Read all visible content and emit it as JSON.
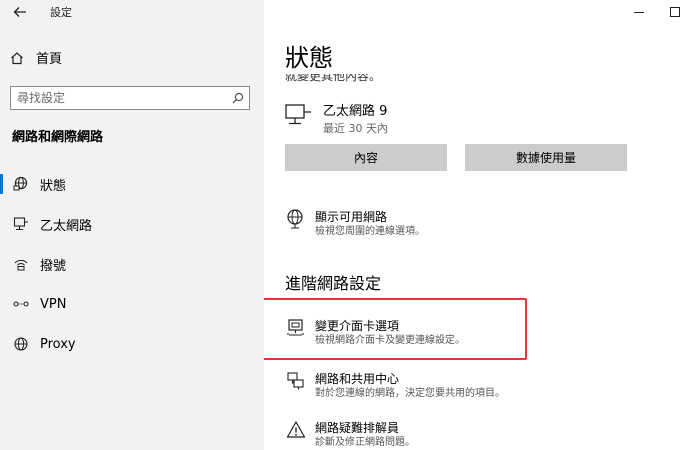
{
  "window": {
    "title": "設定",
    "minimize_icon": "minimize-icon",
    "maximize_icon": "maximize-icon"
  },
  "sidebar": {
    "home_label": "首頁",
    "search_placeholder": "尋找設定",
    "section_title": "網路和網際網路",
    "items": [
      {
        "label": "狀態",
        "icon": "globe-status-icon",
        "active": true
      },
      {
        "label": "乙太網路",
        "icon": "ethernet-icon",
        "active": false
      },
      {
        "label": "撥號",
        "icon": "dialup-icon",
        "active": false
      },
      {
        "label": "VPN",
        "icon": "vpn-icon",
        "active": false
      },
      {
        "label": "Proxy",
        "icon": "globe-icon",
        "active": false
      }
    ]
  },
  "main": {
    "title": "狀態",
    "cutoff_text": "就變更其他內容。",
    "connection": {
      "name": "乙太網路 9",
      "subtitle": "最近 30 天內"
    },
    "buttons": {
      "properties": "內容",
      "data_usage": "數據使用量"
    },
    "show_networks": {
      "title": "顯示可用網路",
      "desc": "檢視您周圍的連線選項。"
    },
    "advanced_heading": "進階網路設定",
    "advanced_items": [
      {
        "title": "變更介面卡選項",
        "desc": "檢視網路介面卡及變更連線設定。"
      },
      {
        "title": "網路和共用中心",
        "desc": "對於您連線的網路，決定您要共用的項目。"
      },
      {
        "title": "網路疑難排解員",
        "desc": "診斷及修正網路問題。"
      }
    ]
  },
  "colors": {
    "accent": "#0078d7",
    "highlight": "#e0383a",
    "sidebar_bg": "#f2f2f2",
    "button_bg": "#cccccc"
  }
}
